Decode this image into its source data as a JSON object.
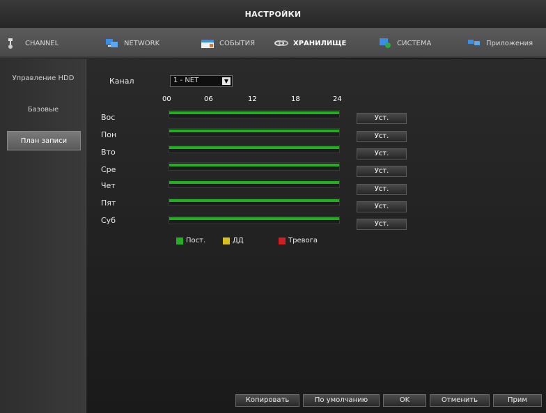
{
  "window": {
    "title": "НАСТРОЙКИ"
  },
  "tabs": [
    {
      "label": "CHANNEL",
      "icon": "camera-icon"
    },
    {
      "label": "NETWORK",
      "icon": "network-icon"
    },
    {
      "label": "СОБЫТИЯ",
      "icon": "events-icon"
    },
    {
      "label": "ХРАНИЛИЩЕ",
      "icon": "storage-icon",
      "active": true
    },
    {
      "label": "СИСТЕМА",
      "icon": "system-icon"
    },
    {
      "label": "Приложения",
      "icon": "apps-icon"
    }
  ],
  "sidebar": {
    "items": [
      {
        "label": "Управление HDD"
      },
      {
        "label": "Базовые"
      },
      {
        "label": "План записи",
        "active": true
      }
    ]
  },
  "channel": {
    "label": "Канал",
    "value": "1 - NET"
  },
  "timeline": {
    "ticks": [
      "00",
      "06",
      "12",
      "18",
      "24"
    ]
  },
  "schedule": {
    "days": [
      "Вос",
      "Пон",
      "Вто",
      "Сре",
      "Чет",
      "Пят",
      "Суб"
    ],
    "set_label": "Уст."
  },
  "legend": [
    {
      "label": "Пост.",
      "color": "#22b022"
    },
    {
      "label": "ДД",
      "color": "#d8c21a"
    },
    {
      "label": "Тревога",
      "color": "#d21e1e"
    }
  ],
  "buttons": {
    "copy": "Копировать",
    "default": "По умолчанию",
    "ok": "OK",
    "cancel": "Отменить",
    "apply": "Прим"
  }
}
